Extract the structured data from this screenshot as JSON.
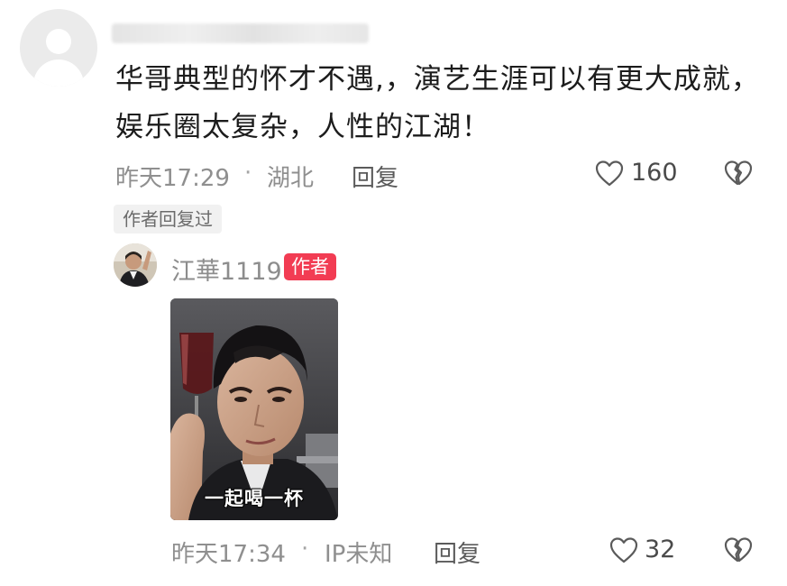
{
  "comment": {
    "username": "",
    "text": "华哥典型的怀才不遇,，演艺生涯可以有更大成就，娱乐圈太复杂，人性的江湖！",
    "time": "昨天17:29",
    "location": "湖北",
    "reply_label": "回复",
    "likes": "160",
    "author_replied": "作者回复过"
  },
  "reply": {
    "username": "江華1119",
    "badge": "作者",
    "gif_caption": "一起喝一杯",
    "time": "昨天17:34",
    "location": "IP未知",
    "reply_label": "回复",
    "likes": "32"
  },
  "colors": {
    "author_badge": "#f23c53",
    "meta_text": "#8f8f8f"
  },
  "icons": {
    "like": "heart-outline-icon",
    "dislike": "broken-heart-icon"
  }
}
